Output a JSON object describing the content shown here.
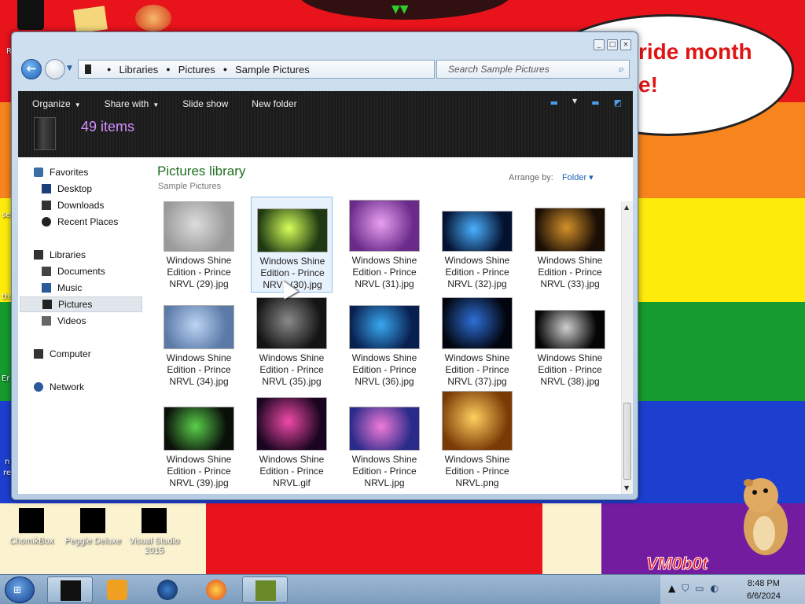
{
  "desktop": {
    "bubble_text": "ride month\ne!",
    "watermark": "VM0b0t",
    "icons": [
      {
        "label": "ChomikBox"
      },
      {
        "label": "Peggle Deluxe"
      },
      {
        "label": "Visual Studio 2015"
      }
    ],
    "edge_labels": [
      "R",
      "se",
      "th",
      "Er",
      "n",
      "re"
    ]
  },
  "window": {
    "caption": {
      "minimize": "_",
      "maximize": "□",
      "close": "×"
    },
    "address": {
      "breadcrumbs": [
        "Libraries",
        "Pictures",
        "Sample Pictures"
      ],
      "search_placeholder": "Search Sample Pictures"
    },
    "toolbar": {
      "organize": "Organize",
      "share_with": "Share with",
      "slide_show": "Slide show",
      "new_folder": "New folder",
      "items_count": "49 items"
    },
    "nav": {
      "favorites": "Favorites",
      "desktop": "Desktop",
      "downloads": "Downloads",
      "recent_places": "Recent Places",
      "libraries": "Libraries",
      "documents": "Documents",
      "music": "Music",
      "pictures": "Pictures",
      "videos": "Videos",
      "computer": "Computer",
      "network": "Network"
    },
    "content": {
      "title": "Pictures library",
      "subtitle": "Sample Pictures",
      "arrange_by_label": "Arrange by:",
      "arrange_by_value": "Folder"
    },
    "files": [
      {
        "line1": "Windows Shine",
        "line2": "Edition - Prince",
        "line3": "NRVL (29).jpg",
        "colors": [
          "#dcdcdc",
          "#9a9a9a"
        ]
      },
      {
        "line1": "Windows Shine",
        "line2": "Edition - Prince",
        "line3": "NRVL (30).jpg",
        "colors": [
          "#d6ff5a",
          "#1f3a12"
        ],
        "selected": true
      },
      {
        "line1": "Windows Shine",
        "line2": "Edition - Prince",
        "line3": "NRVL (31).jpg",
        "colors": [
          "#e8a0f0",
          "#6a2a8a"
        ]
      },
      {
        "line1": "Windows Shine",
        "line2": "Edition - Prince",
        "line3": "NRVL (32).jpg",
        "colors": [
          "#4ab0ff",
          "#041230"
        ]
      },
      {
        "line1": "Windows Shine",
        "line2": "Edition - Prince",
        "line3": "NRVL (33).jpg",
        "colors": [
          "#d4902a",
          "#1a0e05"
        ]
      },
      {
        "line1": "Windows Shine",
        "line2": "Edition - Prince",
        "line3": "NRVL (34).jpg",
        "colors": [
          "#bcd4f4",
          "#5b7aa8"
        ]
      },
      {
        "line1": "Windows Shine",
        "line2": "Edition - Prince",
        "line3": "NRVL (35).jpg",
        "colors": [
          "#8a8a8a",
          "#141414"
        ]
      },
      {
        "line1": "Windows Shine",
        "line2": "Edition - Prince",
        "line3": "NRVL (36).jpg",
        "colors": [
          "#3aa8f0",
          "#082050"
        ]
      },
      {
        "line1": "Windows Shine",
        "line2": "Edition - Prince",
        "line3": "NRVL (37).jpg",
        "colors": [
          "#2e6fd8",
          "#02050e"
        ]
      },
      {
        "line1": "Windows Shine",
        "line2": "Edition - Prince",
        "line3": "NRVL (38).jpg",
        "colors": [
          "#cfcfcf",
          "#050505"
        ]
      },
      {
        "line1": "Windows Shine",
        "line2": "Edition - Prince",
        "line3": "NRVL (39).jpg",
        "colors": [
          "#5ad04a",
          "#0a0f0a"
        ]
      },
      {
        "line1": "Windows Shine",
        "line2": "Edition - Prince",
        "line3": "NRVL.gif",
        "colors": [
          "#f04aa8",
          "#1a0520"
        ]
      },
      {
        "line1": "Windows Shine",
        "line2": "Edition - Prince",
        "line3": "NRVL.jpg",
        "colors": [
          "#f07ad8",
          "#2a2a8a"
        ]
      },
      {
        "line1": "Windows Shine",
        "line2": "Edition - Prince",
        "line3": "NRVL.png",
        "colors": [
          "#ffd060",
          "#7a3a05"
        ]
      }
    ]
  },
  "taskbar": {
    "apps": [
      {
        "icon": "libraries-icon",
        "active": true
      },
      {
        "icon": "media-player-icon"
      },
      {
        "icon": "globe-icon"
      },
      {
        "icon": "firefox-icon"
      },
      {
        "icon": "chomikbox-icon",
        "active": true
      }
    ],
    "clock": {
      "time": "8:48 PM",
      "date": "6/6/2024"
    }
  },
  "colors": {
    "accent": "#1c63b4",
    "library_title": "#1e6e20",
    "items_count": "#d48fff"
  }
}
